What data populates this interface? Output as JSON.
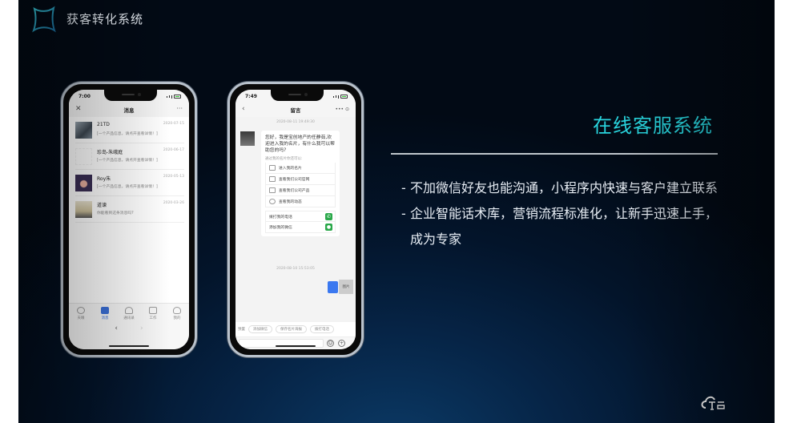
{
  "header": {
    "brand": "获客转化系统",
    "logo_icon": "x-shape-logo-icon"
  },
  "phone1": {
    "time": "7:00",
    "nav_title": "消息",
    "nav_left_icon": "close-icon",
    "nav_right_icon": "more-icon",
    "nav_left": "✕",
    "nav_right": "···",
    "messages": [
      {
        "name": "21TD",
        "date": "2020-07-15",
        "preview": "[一个产品信息，请点开查看详情！]"
      },
      {
        "name": "珍岛-朱峨庭",
        "date": "2020-06-17",
        "preview": "[一个产品信息，请点开查看详情！]"
      },
      {
        "name": "Roy朱",
        "date": "2020-05-13",
        "preview": "[一个产品信息，请点开查看详情！]"
      },
      {
        "name": "道谏",
        "date": "2020-03-26",
        "preview": "你能看到这条消息吗?"
      }
    ],
    "tabs": [
      {
        "label": "天眼",
        "icon": "eye-icon",
        "active": false
      },
      {
        "label": "消息",
        "icon": "message-icon",
        "active": true
      },
      {
        "label": "通讯录",
        "icon": "contacts-icon",
        "active": false
      },
      {
        "label": "工作",
        "icon": "work-icon",
        "active": false
      },
      {
        "label": "我的",
        "icon": "profile-icon",
        "active": false
      }
    ],
    "back_arrow": "‹",
    "forward_arrow": "›"
  },
  "phone2": {
    "time": "7:49",
    "nav_title": "留言",
    "nav_left": "‹",
    "nav_right": "•••  ⊙",
    "timestamp1": "2020-08-11 19:49:30",
    "greeting": "您好，我是宝创地产的任静茹,欢迎进入我的名片，有什么我可以帮助您的吗?",
    "hint": "通过我的名片你还可以:",
    "options": [
      {
        "label": "进入我的名片",
        "icon": "card-icon"
      },
      {
        "label": "查看我们公司官网",
        "icon": "monitor-icon"
      },
      {
        "label": "查看我们公司产品",
        "icon": "grid-icon"
      },
      {
        "label": "查看我的动态",
        "icon": "compass-icon"
      }
    ],
    "actions": [
      {
        "label": "拨打我的电话",
        "icon": "phone-icon",
        "glyph": "✆"
      },
      {
        "label": "添加我的微信",
        "icon": "wechat-icon",
        "glyph": "●"
      }
    ],
    "timestamp2": "2020-08-10 15:53:05",
    "image_label": "图片",
    "quick_label": "预置",
    "quick_chips": [
      "添加微信",
      "保存名片海报",
      "拨打电话"
    ],
    "emoji": "☺",
    "plus": "+"
  },
  "main": {
    "title": "在线客服系统",
    "bullets": [
      "不加微信好友也能沟通，小程序内快速与客户建立联系",
      "企业智能话术库，营销流程标准化，让新手迅速上手，成为专家"
    ],
    "dash": "-"
  },
  "colors": {
    "accent": "#29d6df",
    "background": "#03142a",
    "active_tab": "#3a6fd8",
    "wechat_green": "#2aa84a"
  }
}
